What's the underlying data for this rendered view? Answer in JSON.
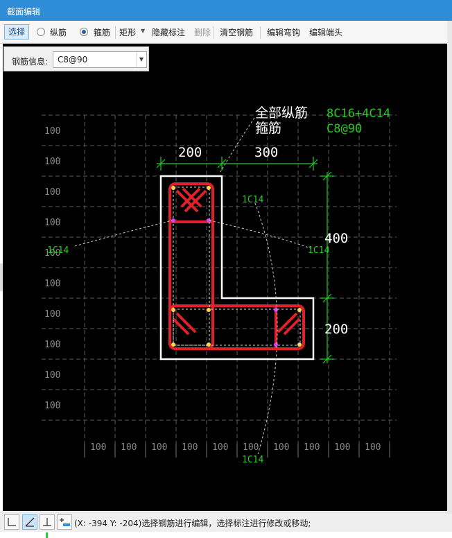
{
  "window": {
    "title": "截面编辑"
  },
  "toolbar": {
    "select_label": "选择",
    "radio_long_rebar": "纵筋",
    "radio_stirrup": "箍筋",
    "shape_label": "矩形",
    "hide_label": "隐藏标注",
    "delete_label": "删除",
    "clear_label": "清空钢筋",
    "edit_hook_label": "编辑弯钩",
    "edit_end_label": "编辑端头",
    "selected_radio": "箍筋"
  },
  "rebar_info": {
    "label": "钢筋信息:",
    "value": "C8@90"
  },
  "drawing": {
    "grid_labels": [
      "100",
      "100",
      "100",
      "100",
      "100",
      "100",
      "100",
      "100",
      "100",
      "100",
      "100",
      "100"
    ],
    "dim_200_top": "200",
    "dim_300_top": "300",
    "dim_400_right": "400",
    "dim_200_right": "200",
    "legend_long": "全部纵筋",
    "legend_stirrup": "箍筋",
    "value_long": "8C16+4C14",
    "value_stirrup": "C8@90",
    "rebar_label_1": "1C14",
    "rebar_label_2": "1C14",
    "rebar_label_3": "1C14",
    "rebar_label_4": "1C14"
  },
  "status": {
    "text": "(X: -394 Y: -204)选择钢筋进行编辑，选择标注进行修改或移动;"
  },
  "colors": {
    "accent": "#2f8dd8",
    "rebar_red": "#e0202a",
    "annotation_green": "#22cc22",
    "outline_white": "#ffffff"
  }
}
